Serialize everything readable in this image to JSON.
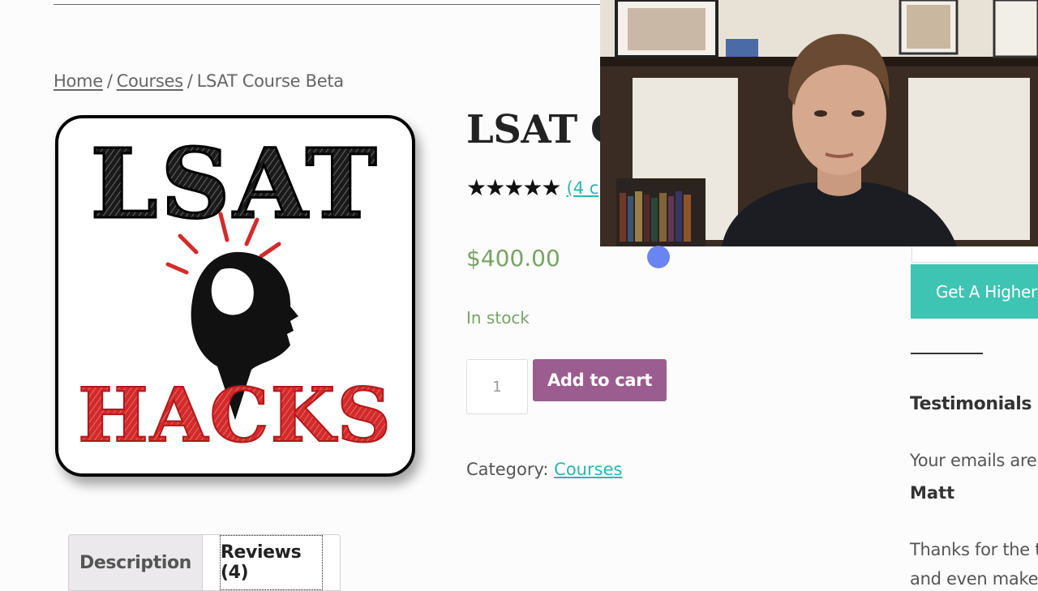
{
  "breadcrumb": {
    "home": "Home",
    "separator": "/",
    "courses": "Courses",
    "current": "LSAT Course Beta"
  },
  "logo": {
    "top_text": "LSAT",
    "bottom_text": "HACKS"
  },
  "product": {
    "title": "LSAT C",
    "stars": "★★★★★",
    "rating_value": 5,
    "review_link": "(4 c",
    "price": "$400.00",
    "stock": "In stock",
    "quantity": "1",
    "add_to_cart": "Add to cart",
    "category_label": "Category:",
    "category_link": "Courses"
  },
  "tabs": [
    {
      "label": "Description"
    },
    {
      "label": "Reviews (4)"
    }
  ],
  "sidebar": {
    "cta_button": "Get A Higher S",
    "testimonials_heading": "Testimonials",
    "testimonial_1_text": "Your emails are",
    "testimonial_1_author": "Matt",
    "testimonial_2_text": "Thanks for the t",
    "testimonial_2_text_cont": "and even make y"
  },
  "colors": {
    "price_green": "#77a464",
    "link_teal": "#2bb6b0",
    "cart_purple": "#9b5c8f",
    "cta_teal": "#3dc4b3",
    "logo_red": "#d42a2a",
    "cursor_blue": "#5a78f0"
  }
}
